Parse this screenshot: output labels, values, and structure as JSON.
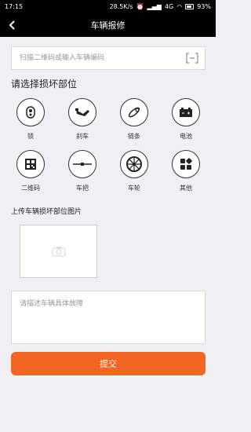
{
  "status_bar": {
    "time": "17:15",
    "network_speed": "28.5K/s",
    "network_type": "4G",
    "battery": "93%"
  },
  "header": {
    "title": "车辆报修",
    "back_icon": "back-arrow-icon"
  },
  "scan": {
    "placeholder": "扫描二维码或输入车辆编码",
    "icon": "scan-icon"
  },
  "section": {
    "title": "请选择损坏部位"
  },
  "parts": [
    {
      "label": "锁",
      "icon": "lock-icon"
    },
    {
      "label": "刹车",
      "icon": "brake-icon"
    },
    {
      "label": "链条",
      "icon": "chain-icon"
    },
    {
      "label": "电池",
      "icon": "battery-icon"
    },
    {
      "label": "二维码",
      "icon": "qrcode-icon"
    },
    {
      "label": "车把",
      "icon": "handlebar-icon"
    },
    {
      "label": "车轮",
      "icon": "wheel-icon"
    },
    {
      "label": "其他",
      "icon": "other-icon"
    }
  ],
  "upload": {
    "title": "上传车辆损坏部位图片",
    "icon": "camera-icon"
  },
  "description": {
    "placeholder": "请描述车辆具体故障"
  },
  "submit": {
    "label": "提交",
    "color": "#f26522"
  }
}
